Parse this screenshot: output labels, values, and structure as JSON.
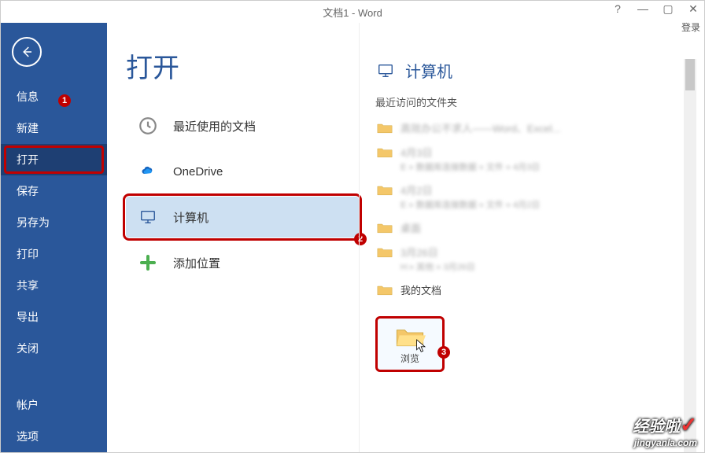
{
  "titlebar": {
    "title": "文档1 - Word",
    "help": "?",
    "min": "—",
    "restore": "▢",
    "close": "✕",
    "login": "登录"
  },
  "sidebar": {
    "items": [
      {
        "label": "信息"
      },
      {
        "label": "新建"
      },
      {
        "label": "打开"
      },
      {
        "label": "保存"
      },
      {
        "label": "另存为"
      },
      {
        "label": "打印"
      },
      {
        "label": "共享"
      },
      {
        "label": "导出"
      },
      {
        "label": "关闭"
      }
    ],
    "bottom": [
      {
        "label": "帐户"
      },
      {
        "label": "选项"
      }
    ]
  },
  "page": {
    "title": "打开",
    "sources": [
      {
        "label": "最近使用的文档"
      },
      {
        "label": "OneDrive"
      },
      {
        "label": "计算机"
      },
      {
        "label": "添加位置"
      }
    ]
  },
  "right": {
    "title": "计算机",
    "subtitle": "最近访问的文件夹",
    "folders": [
      {
        "name": "高效办公不求人——Word、Excel...",
        "sub": ""
      },
      {
        "name": "4月3日",
        "sub": "E » 数据库连接数据 » 文件 » 4月3日"
      },
      {
        "name": "4月2日",
        "sub": "E » 数据库连接数据 » 文件 » 4月2日"
      },
      {
        "name": "桌面",
        "sub": ""
      },
      {
        "name": "3月26日",
        "sub": "H:» 其他 » 3月26日"
      },
      {
        "name": "我的文档",
        "sub": ""
      }
    ],
    "browse": {
      "label": "浏览"
    }
  },
  "badges": {
    "b1": "1",
    "b2": "2",
    "b3": "3"
  },
  "watermark": {
    "main": "经验啦",
    "sub": "jingyanla.com"
  }
}
